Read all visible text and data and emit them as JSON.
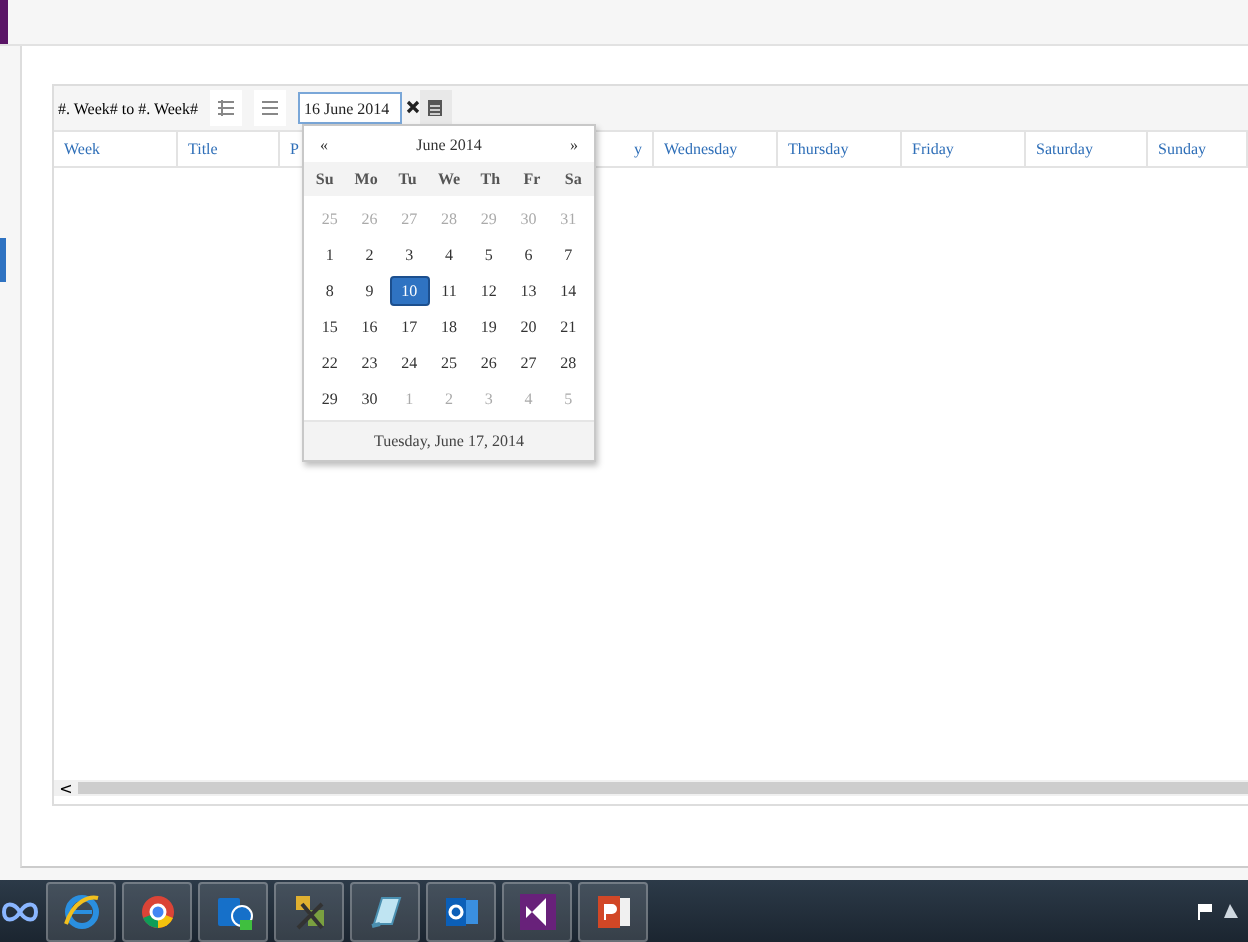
{
  "toolbar": {
    "week_range": "#. Week# to #. Week#",
    "date_value": "16 June 2014"
  },
  "table": {
    "columns": [
      {
        "label": "Week"
      },
      {
        "label": "Title"
      },
      {
        "label": "P"
      },
      {
        "label": "y"
      },
      {
        "label": "Wednesday"
      },
      {
        "label": "Thursday"
      },
      {
        "label": "Friday"
      },
      {
        "label": "Saturday"
      },
      {
        "label": "Sunday"
      }
    ]
  },
  "calendar": {
    "prev": "«",
    "next": "»",
    "month": "June 2014",
    "weekdays": [
      "Su",
      "Mo",
      "Tu",
      "We",
      "Th",
      "Fr",
      "Sa"
    ],
    "weeks": [
      [
        {
          "day": "25",
          "outside": true,
          "selected": false
        },
        {
          "day": "26",
          "outside": true,
          "selected": false
        },
        {
          "day": "27",
          "outside": true,
          "selected": false
        },
        {
          "day": "28",
          "outside": true,
          "selected": false
        },
        {
          "day": "29",
          "outside": true,
          "selected": false
        },
        {
          "day": "30",
          "outside": true,
          "selected": false
        },
        {
          "day": "31",
          "outside": true,
          "selected": false
        }
      ],
      [
        {
          "day": "1",
          "outside": false,
          "selected": false
        },
        {
          "day": "2",
          "outside": false,
          "selected": false
        },
        {
          "day": "3",
          "outside": false,
          "selected": false
        },
        {
          "day": "4",
          "outside": false,
          "selected": false
        },
        {
          "day": "5",
          "outside": false,
          "selected": false
        },
        {
          "day": "6",
          "outside": false,
          "selected": false
        },
        {
          "day": "7",
          "outside": false,
          "selected": false
        }
      ],
      [
        {
          "day": "8",
          "outside": false,
          "selected": false
        },
        {
          "day": "9",
          "outside": false,
          "selected": false
        },
        {
          "day": "10",
          "outside": false,
          "selected": true
        },
        {
          "day": "11",
          "outside": false,
          "selected": false
        },
        {
          "day": "12",
          "outside": false,
          "selected": false
        },
        {
          "day": "13",
          "outside": false,
          "selected": false
        },
        {
          "day": "14",
          "outside": false,
          "selected": false
        }
      ],
      [
        {
          "day": "15",
          "outside": false,
          "selected": false
        },
        {
          "day": "16",
          "outside": false,
          "selected": false
        },
        {
          "day": "17",
          "outside": false,
          "selected": false
        },
        {
          "day": "18",
          "outside": false,
          "selected": false
        },
        {
          "day": "19",
          "outside": false,
          "selected": false
        },
        {
          "day": "20",
          "outside": false,
          "selected": false
        },
        {
          "day": "21",
          "outside": false,
          "selected": false
        }
      ],
      [
        {
          "day": "22",
          "outside": false,
          "selected": false
        },
        {
          "day": "23",
          "outside": false,
          "selected": false
        },
        {
          "day": "24",
          "outside": false,
          "selected": false
        },
        {
          "day": "25",
          "outside": false,
          "selected": false
        },
        {
          "day": "26",
          "outside": false,
          "selected": false
        },
        {
          "day": "27",
          "outside": false,
          "selected": false
        },
        {
          "day": "28",
          "outside": false,
          "selected": false
        }
      ],
      [
        {
          "day": "29",
          "outside": false,
          "selected": false
        },
        {
          "day": "30",
          "outside": false,
          "selected": false
        },
        {
          "day": "1",
          "outside": true,
          "selected": false
        },
        {
          "day": "2",
          "outside": true,
          "selected": false
        },
        {
          "day": "3",
          "outside": true,
          "selected": false
        },
        {
          "day": "4",
          "outside": true,
          "selected": false
        },
        {
          "day": "5",
          "outside": true,
          "selected": false
        }
      ]
    ],
    "today": "Tuesday, June 17, 2014"
  },
  "scrollbar": {
    "left_arrow": "<"
  },
  "taskbar": {
    "apps": [
      {
        "kind": "infinity"
      },
      {
        "kind": "ie"
      },
      {
        "kind": "chrome"
      },
      {
        "kind": "lync"
      },
      {
        "kind": "tools"
      },
      {
        "kind": "notes"
      },
      {
        "kind": "outlook"
      },
      {
        "kind": "vs"
      },
      {
        "kind": "ppt"
      }
    ]
  }
}
